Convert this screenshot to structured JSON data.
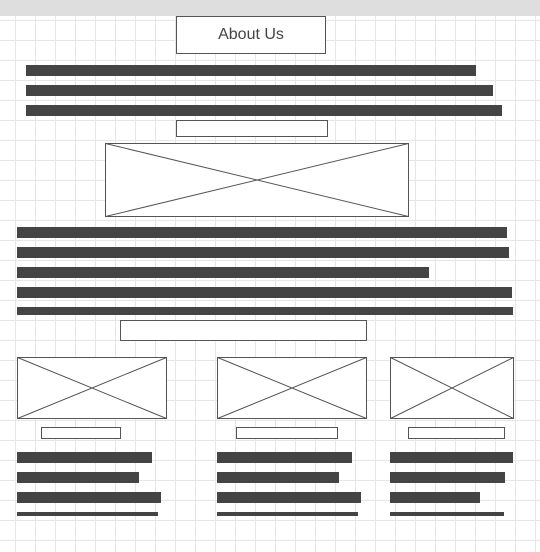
{
  "header": {
    "title": "About Us"
  },
  "placeholders": {
    "main_image_icon": "image-placeholder-icon",
    "column_image_icon": "image-placeholder-icon"
  },
  "colors": {
    "text_bar": "#444444",
    "border": "#555555",
    "grid": "#e6e6e6",
    "top_strip": "#dedede"
  }
}
